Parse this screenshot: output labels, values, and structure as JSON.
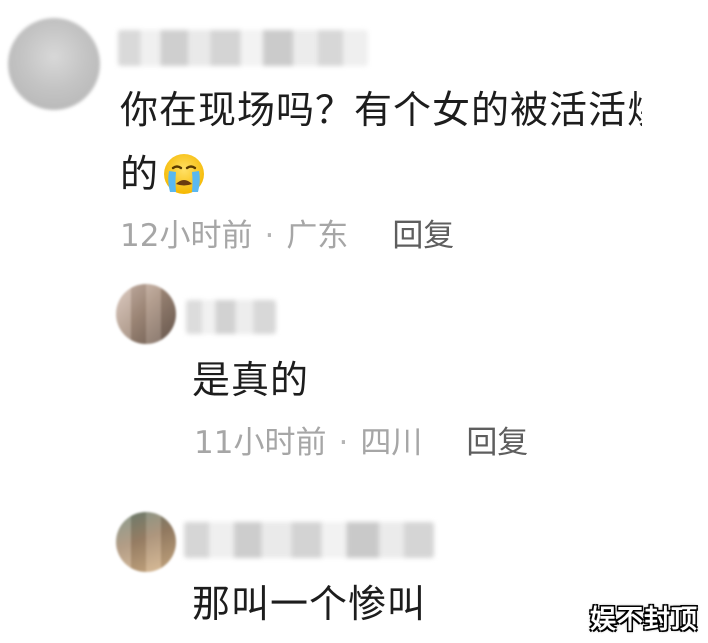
{
  "comments": [
    {
      "text_line1": "你在现场吗？有个女的被活活烧",
      "text_line2": "的",
      "time": "12小时前",
      "location": "广东",
      "separator": "·",
      "reply_label": "回复",
      "emoji": "crying-face-icon"
    },
    {
      "text": "是真的",
      "time": "11小时前",
      "location": "四川",
      "separator": "·",
      "reply_label": "回复"
    },
    {
      "text": "那叫一个惨叫"
    }
  ],
  "watermark": "娱不封顶",
  "colors": {
    "text": "#1d1d1d",
    "meta": "#a6a6a6",
    "reply": "#5e5e5e",
    "background": "#ffffff"
  }
}
